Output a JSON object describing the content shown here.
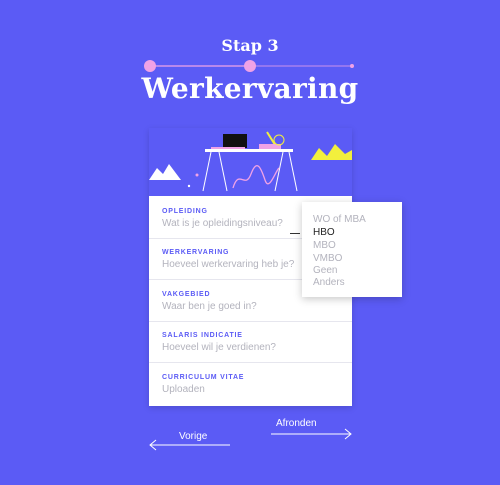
{
  "step": {
    "label": "Stap 3",
    "current": 3,
    "total": 4
  },
  "page": {
    "title": "Werkervaring"
  },
  "form": {
    "fields": [
      {
        "label": "Opleiding",
        "placeholder": "Wat is je opleidingsniveau?"
      },
      {
        "label": "Werkervaring",
        "placeholder": "Hoeveel werkervaring heb je?"
      },
      {
        "label": "Vakgebied",
        "placeholder": "Waar ben je goed in?"
      },
      {
        "label": "Salaris indicatie",
        "placeholder": "Hoeveel wil je verdienen?"
      },
      {
        "label": "Curriculum vitae",
        "placeholder": "Uploaden"
      }
    ]
  },
  "dropdown": {
    "options": [
      "WO of MBA",
      "HBO",
      "MBO",
      "VMBO",
      "Geen",
      "Anders"
    ],
    "selected": "HBO"
  },
  "nav": {
    "prev_label": "Vorige",
    "next_label": "Afronden"
  },
  "colors": {
    "background": "#5b5bf5",
    "accent_pink": "#f0a2e6",
    "accent_yellow": "#f2ef3d",
    "label": "#5b5bf5",
    "placeholder": "#b3b3bd"
  }
}
